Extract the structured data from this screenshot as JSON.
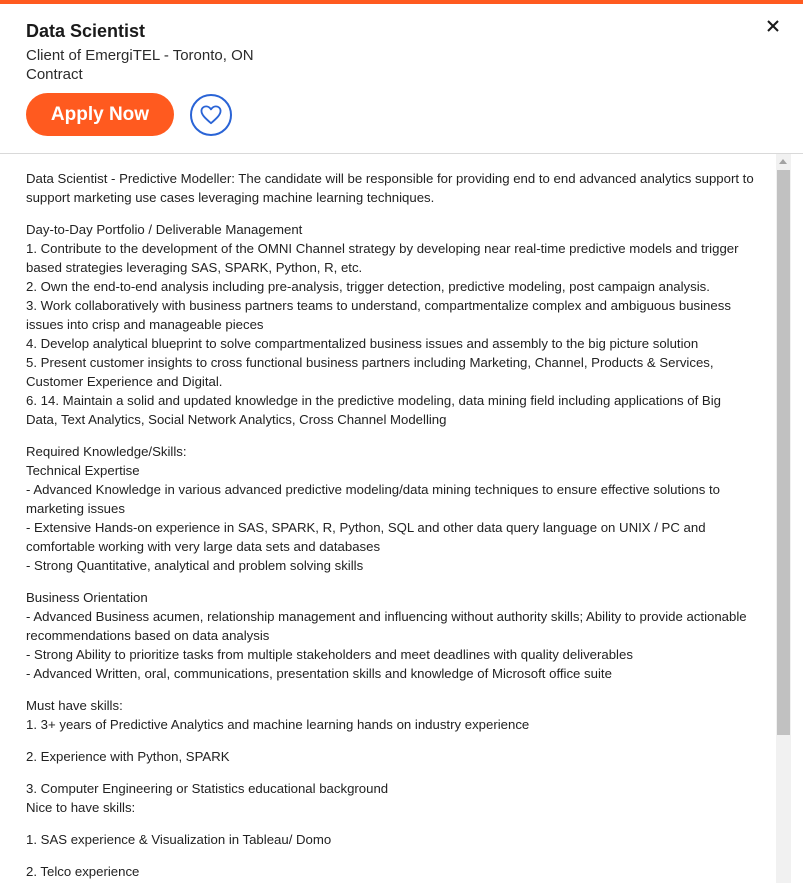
{
  "job": {
    "title": "Data Scientist",
    "company_location": "Client of EmergiTEL - Toronto, ON",
    "job_type": "Contract"
  },
  "actions": {
    "apply_label": "Apply Now"
  },
  "icons": {
    "close": "close-icon",
    "favorite": "heart-icon"
  },
  "colors": {
    "accent": "#ff5a1f",
    "favorite_outline": "#2a64d6"
  },
  "description": {
    "intro": "Data Scientist - Predictive Modeller: The candidate will be responsible for providing end to end advanced analytics support to support marketing use cases leveraging machine learning techniques.",
    "portfolio": [
      "Day-to-Day Portfolio / Deliverable Management",
      "1. Contribute to the development of the OMNI Channel strategy by developing near real-time predictive models and trigger based strategies leveraging SAS, SPARK, Python, R, etc.",
      "2. Own the end-to-end analysis including pre-analysis, trigger detection, predictive modeling, post campaign analysis.",
      "3. Work collaboratively with business partners teams to understand, compartmentalize complex and ambiguous business issues into crisp and manageable pieces",
      "4. Develop analytical blueprint to solve compartmentalized business issues and assembly to the big picture solution",
      "5. Present customer insights to cross functional business partners including Marketing, Channel, Products & Services, Customer Experience and Digital.",
      "6. 14. Maintain a solid and updated knowledge in the predictive modeling, data mining field including applications of Big Data, Text Analytics, Social Network Analytics, Cross Channel Modelling"
    ],
    "skills": [
      "Required Knowledge/Skills:",
      "Technical Expertise",
      "- Advanced Knowledge in various advanced predictive modeling/data mining techniques to ensure effective solutions to marketing issues",
      "- Extensive Hands-on experience in SAS, SPARK, R, Python, SQL and other data query language on UNIX / PC and comfortable working with very large data sets and databases",
      "- Strong Quantitative, analytical and problem solving skills"
    ],
    "business": [
      "Business Orientation",
      "- Advanced Business acumen, relationship management and influencing without authority skills; Ability to provide actionable recommendations based on data analysis",
      "- Strong Ability to prioritize tasks from multiple stakeholders and meet deadlines with quality deliverables",
      "- Advanced Written, oral, communications, presentation skills and knowledge of Microsoft office suite"
    ],
    "must_have": [
      "Must have skills:",
      "1. 3+ years of Predictive Analytics and machine learning hands on industry experience"
    ],
    "python": "2. Experience with Python, SPARK",
    "education": [
      "3. Computer Engineering or Statistics educational background",
      "Nice to have skills:"
    ],
    "sas": "1. SAS experience & Visualization in Tableau/ Domo",
    "telco": "2. Telco experience"
  }
}
